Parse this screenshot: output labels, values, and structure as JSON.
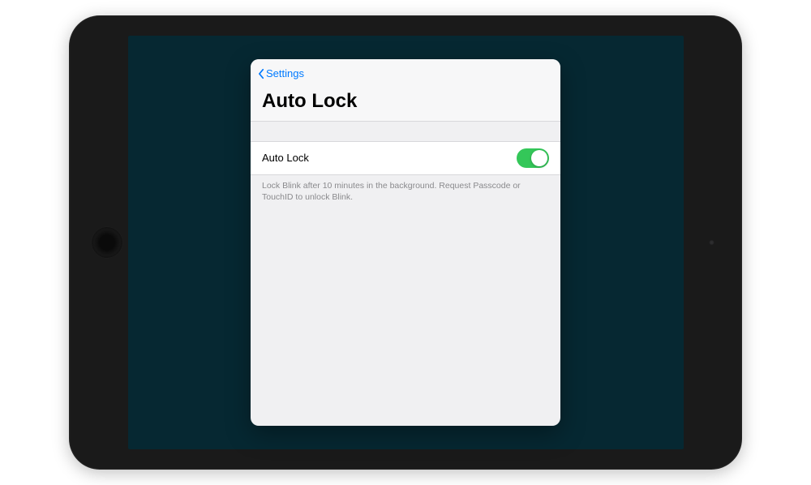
{
  "nav": {
    "back_label": "Settings"
  },
  "header": {
    "title": "Auto Lock"
  },
  "row": {
    "label": "Auto Lock",
    "toggle_on": true
  },
  "footer": {
    "text": "Lock Blink after 10 minutes in the background. Request Passcode or TouchID to unlock Blink."
  }
}
